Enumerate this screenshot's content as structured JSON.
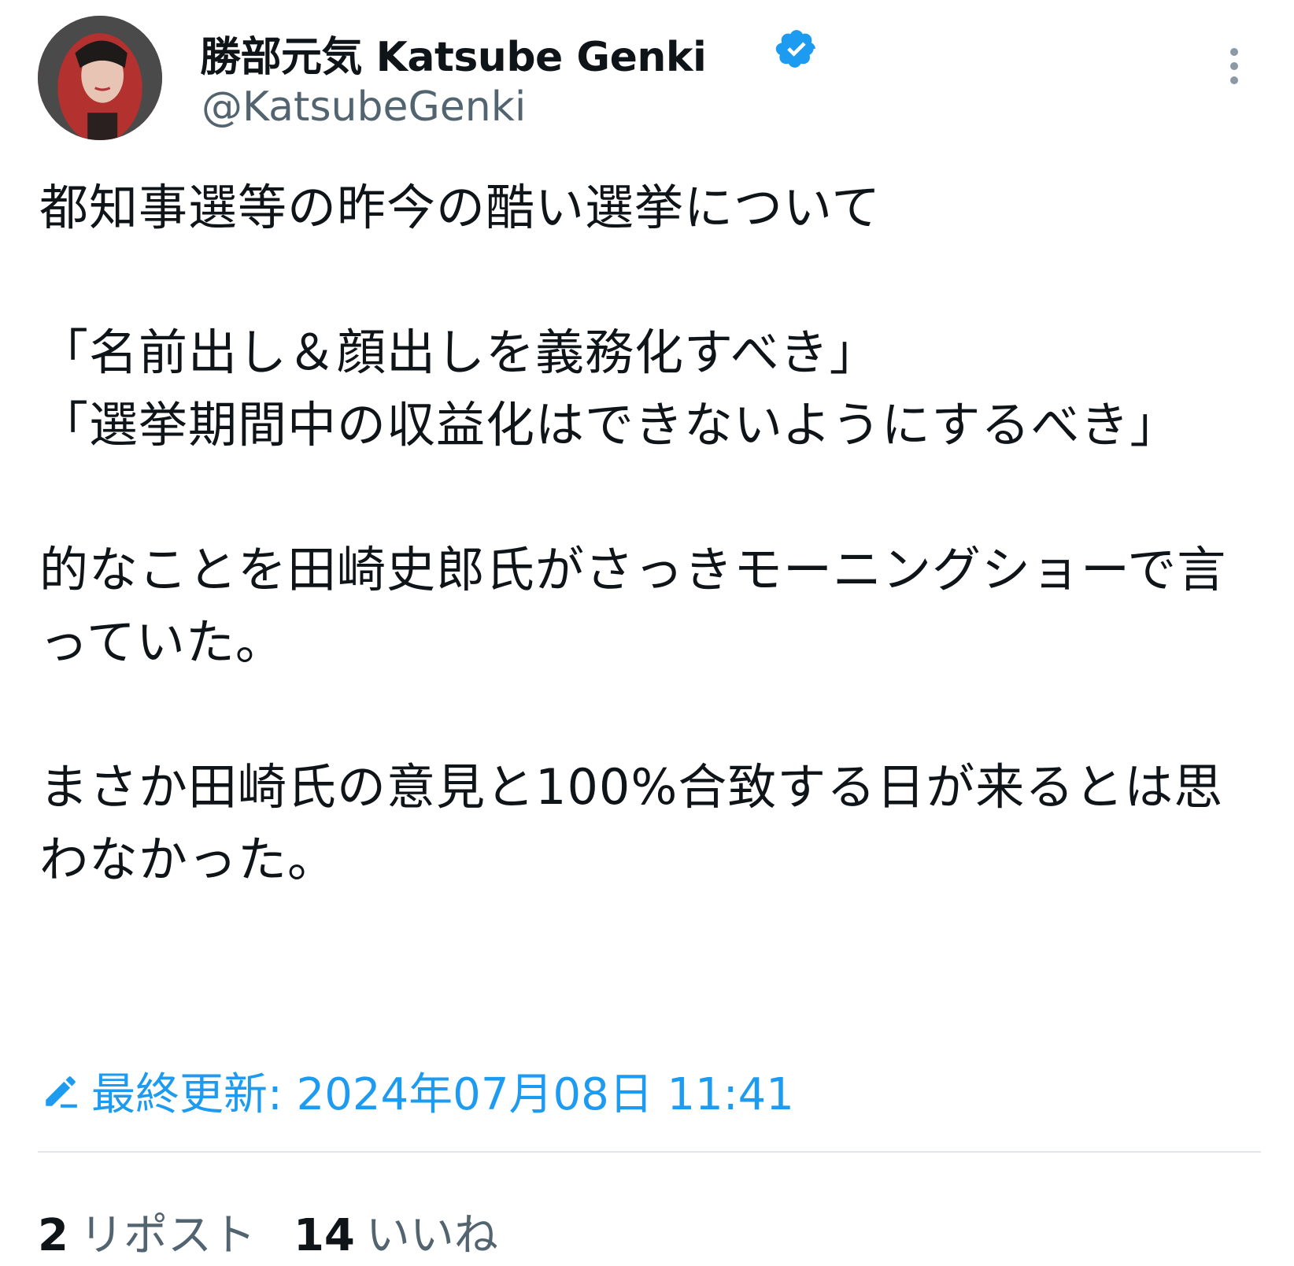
{
  "author": {
    "display_name": "勝部元気 Katsube Genki",
    "handle": "@KatsubeGenki",
    "verified_icon": "verified-badge-icon",
    "verified_color": "#1d9bf0"
  },
  "menu_icon": "more-vertical-icon",
  "tweet": {
    "text": "都知事選等の昨今の酷い選挙について\n\n「名前出し＆顔出しを義務化すべき」\n「選挙期間中の収益化はできないようにするべき」\n\n的なことを田崎史郎氏がさっきモーニングショーで言っていた。\n\nまさか田崎氏の意見と100%合致する日が来るとは思わなかった。"
  },
  "edited": {
    "icon": "pencil-icon",
    "label": "最終更新: 2024年07月08日 11:41",
    "color": "#1d9bf0"
  },
  "stats": {
    "reposts_count": "2",
    "reposts_label": "リポスト",
    "likes_count": "14",
    "likes_label": "いいね"
  }
}
